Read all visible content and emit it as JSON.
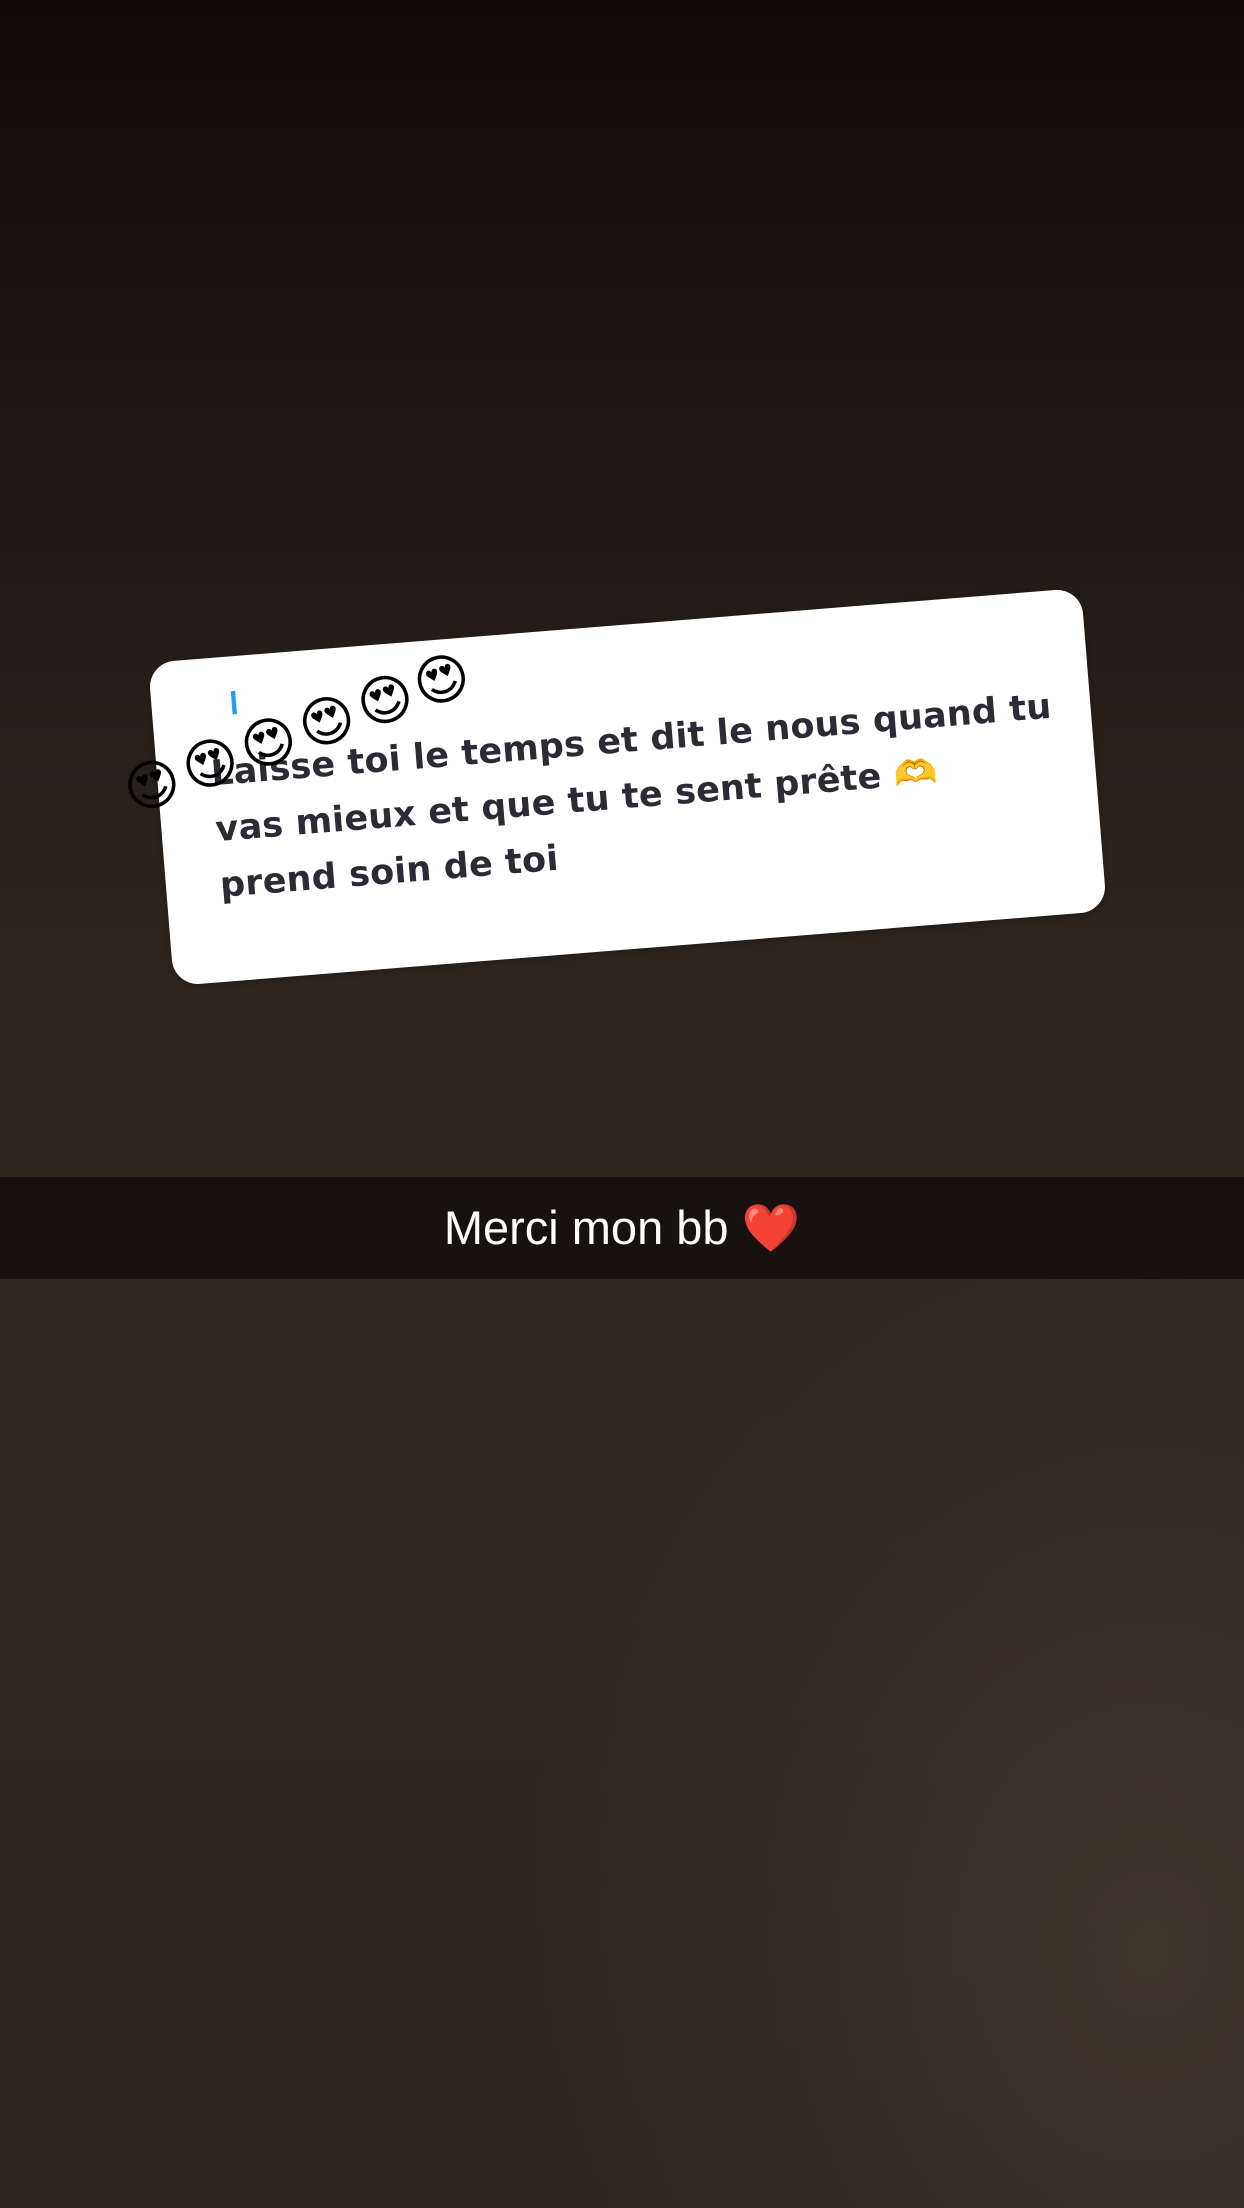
{
  "story": {
    "quoted_reply": {
      "name_fragment": "l",
      "emojis": [
        "😍",
        "😍",
        "😍",
        "😍",
        "😍",
        "😍"
      ],
      "message": "Laisse toi le temps et dit le nous quand tu vas mieux et que tu te sent prête 🫶 prend soin de toi"
    },
    "caption": "Merci mon bb ❤️"
  },
  "colors": {
    "sticker_background": "#ffffff",
    "sticker_text": "#2b2b35",
    "name_accent": "#2d9bf0",
    "caption_bar": "#0e0b0a",
    "caption_text": "#ffffff"
  }
}
